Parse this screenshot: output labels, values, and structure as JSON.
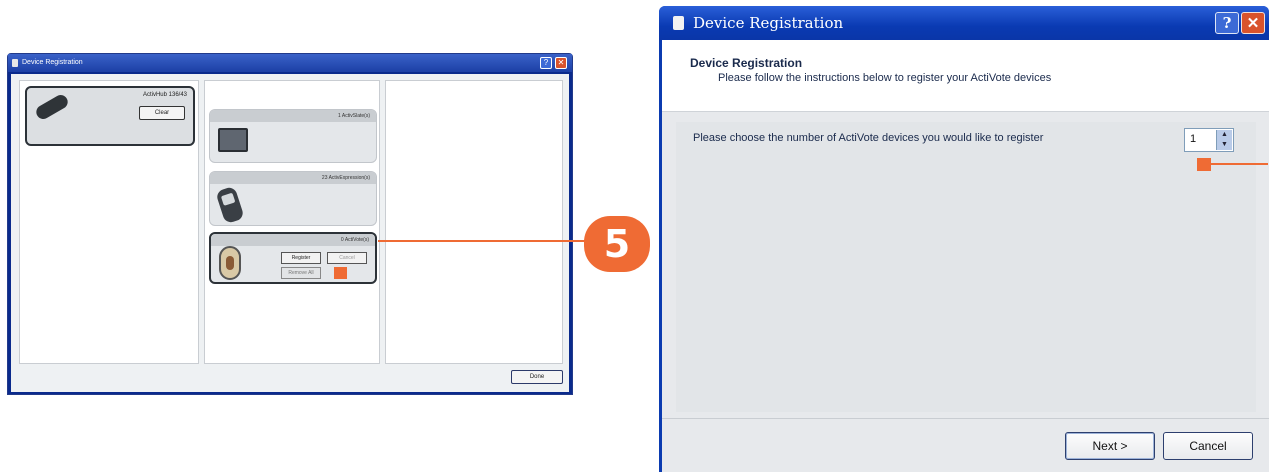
{
  "small_window": {
    "title": "Device Registration",
    "help_glyph": "?",
    "close_glyph": "✕",
    "hub": {
      "label": "ActivHub 136/43",
      "clear_label": "Clear"
    },
    "activslate": {
      "label": "1 ActivSlate(s)"
    },
    "activexpression": {
      "label": "23 ActivExpression(s)"
    },
    "activote": {
      "label": "0 ActiVote(s)",
      "register_label": "Register",
      "cancel_label": "Cancel",
      "remove_label": "Remove All"
    },
    "done_label": "Done"
  },
  "callout": {
    "step_number": "5",
    "color": "#ef6b34"
  },
  "large_window": {
    "title": "Device Registration",
    "help_glyph": "?",
    "close_glyph": "✕",
    "header_title": "Device Registration",
    "header_subtitle": "Please follow the instructions below to register your ActiVote devices",
    "prompt": "Please choose the number of ActiVote devices you would like to register",
    "spinner_value": "1",
    "next_label": "Next >",
    "cancel_label": "Cancel"
  },
  "colors": {
    "title_bar": "#0a3ab2",
    "accent": "#ef6b34"
  }
}
